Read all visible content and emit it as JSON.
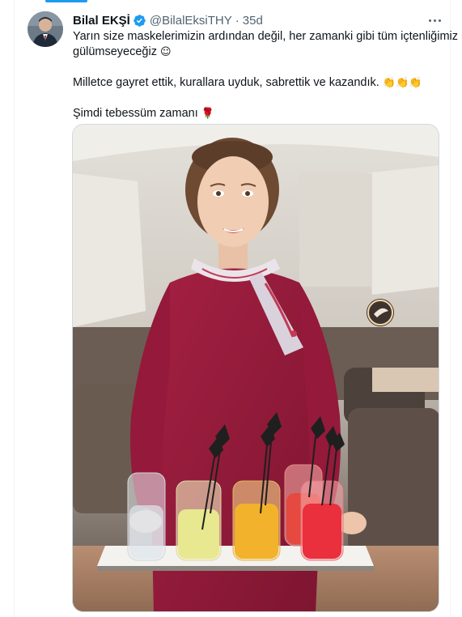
{
  "tweet": {
    "author_name": "Bilal EKŞİ",
    "handle": "@BilalEksiTHY",
    "separator": "·",
    "time": "35d",
    "lines": {
      "l1": "Yarın size maskelerimizin ardından değil, her zamanki gibi tüm içtenliğimiz ile",
      "l2": "gülümseyeceğiz",
      "l2_emoji": "☺",
      "l3": "Milletce gayret ettik, kurallara uyduk, sabrettik ve kazandık.",
      "l3_emoji": "👏👏👏",
      "l4": "Şimdi tebessüm zamanı",
      "l4_emoji": "🌹"
    }
  },
  "icons": {
    "verified": "verified-badge-icon",
    "more": "more-options-icon"
  },
  "colors": {
    "accent": "#1d9bf0",
    "secondary_text": "#536471",
    "uniform": "#9b1b3a",
    "divider": "#eff3f4"
  }
}
